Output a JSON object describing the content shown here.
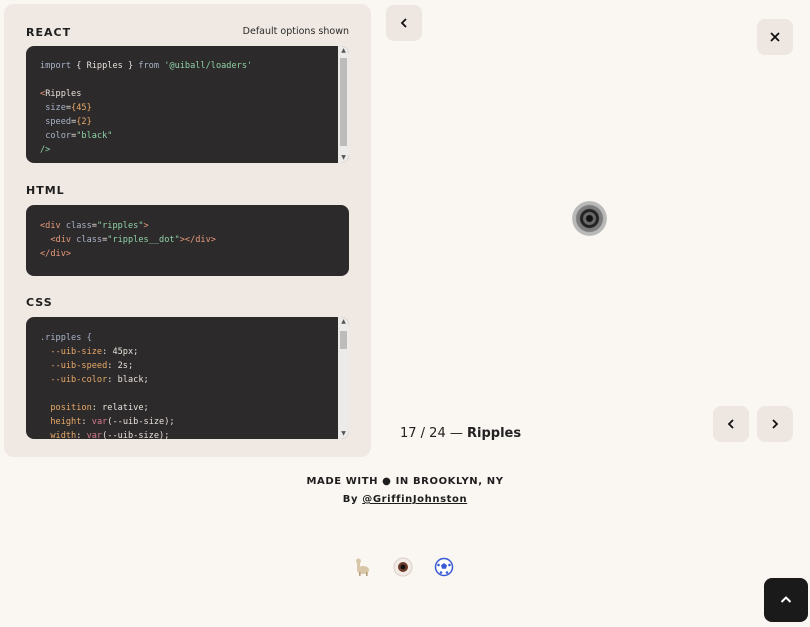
{
  "panel": {
    "react": {
      "title": "REACT",
      "note": "Default options shown",
      "code": {
        "l1": {
          "kw1": "import",
          "b1": " { ",
          "name": "Ripples",
          "b2": " } ",
          "kw2": "from",
          "str": "'@uiball/loaders'"
        },
        "l3": {
          "lt": "<",
          "tag": "Ripples"
        },
        "size": {
          "attr": "size",
          "eq": "=",
          "val": "{45}"
        },
        "speed": {
          "attr": "speed",
          "eq": "=",
          "val": "{2}"
        },
        "color": {
          "attr": "color",
          "eq": "=",
          "val": "\"black\""
        },
        "close": "/>"
      }
    },
    "html": {
      "title": "HTML",
      "code": {
        "l1": {
          "open": "<div ",
          "attr": "class",
          "eq": "=",
          "val": "\"ripples\"",
          "close": ">"
        },
        "l2": {
          "open": "  <div ",
          "attr": "class",
          "eq": "=",
          "val": "\"ripples__dot\"",
          "close": "></div>"
        },
        "l3": "</div>"
      }
    },
    "css": {
      "title": "CSS",
      "code": {
        "sel": ".ripples {",
        "p1": {
          "prop": "  --uib-size",
          "sep": ": ",
          "val": "45px;"
        },
        "p2": {
          "prop": "  --uib-speed",
          "sep": ": ",
          "val": "2s;"
        },
        "p3": {
          "prop": "  --uib-color",
          "sep": ": ",
          "val": "black;"
        },
        "p4": {
          "prop": "  position",
          "sep": ": ",
          "val": "relative;"
        },
        "p5": {
          "prop": "  height",
          "sep": ": ",
          "fn": "var",
          "val": "(--uib-size);"
        },
        "p6": {
          "prop": "  width",
          "sep": ": ",
          "fn": "var",
          "val": "(--uib-size);"
        }
      }
    }
  },
  "counter": {
    "pos": "17 / 24 — ",
    "name": "Ripples"
  },
  "footer": {
    "made_with": "MADE WITH ● IN BROOKLYN, NY",
    "by": "By ",
    "handle": "@GriffinJohnston"
  },
  "icons": {
    "back": "chevron-left-icon",
    "close": "close-icon",
    "prev": "chevron-left-icon",
    "next": "chevron-right-icon",
    "top": "chevron-up-icon",
    "foot": [
      "llama-icon",
      "eyeball-icon",
      "soccer-ball-icon"
    ]
  },
  "colors": {
    "code_bg": "#2d2a2b",
    "panel_bg": "#efe8e3",
    "page_bg": "#faf6f1"
  }
}
